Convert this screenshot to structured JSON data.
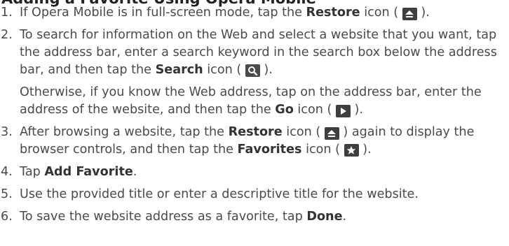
{
  "heading": "Adding a Favorite Using Opera Mobile",
  "steps": [
    {
      "number": "1.",
      "p1": "If Opera Mobile is in full-screen mode, tap the ",
      "t1": "Restore",
      "p2": " icon ( ",
      "p3": " )."
    },
    {
      "number": "2.",
      "p1": "To search for information on the Web and select a website that you want, tap the address bar, enter a search keyword in the search box below the address bar, and then tap the ",
      "t1": "Search",
      "p2": " icon ( ",
      "p3": " ).",
      "c1": "Otherwise, if you know the Web address, tap on the address bar, enter the address of the website, and then tap the ",
      "ct1": "Go",
      "c2": " icon ( ",
      "c3": " )."
    },
    {
      "number": "3.",
      "p1": "After browsing a website, tap the ",
      "t1": "Restore",
      "p2": " icon ( ",
      "p3": " ) again to display the browser controls, and then tap the ",
      "t2": "Favorites",
      "p4": " icon ( ",
      "p5": " )."
    },
    {
      "number": "4.",
      "p1": "Tap ",
      "t1": "Add Favorite",
      "p2": "."
    },
    {
      "number": "5.",
      "p1": "Use the provided title or enter a descriptive title for the website."
    },
    {
      "number": "6.",
      "p1": "To save the website address as a favorite, tap ",
      "t1": "Done",
      "p2": "."
    }
  ],
  "icons": {
    "restore": "restore-icon",
    "search": "search-icon",
    "go": "go-icon",
    "favorites": "favorites-icon"
  },
  "colors": {
    "text": "#4a4a4a",
    "icon_bg": "#3f3f3f",
    "icon_fg": "#ffffff"
  }
}
